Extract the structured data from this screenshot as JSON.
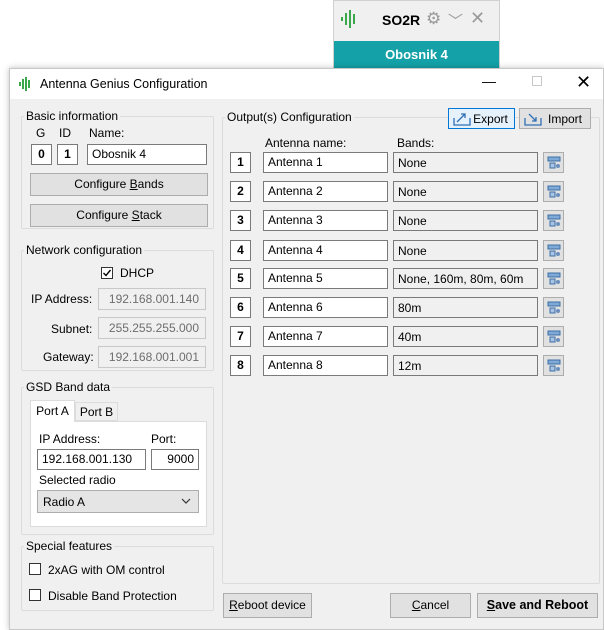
{
  "widget": {
    "title": "SO2R",
    "band": "Obosnik 4"
  },
  "window": {
    "title": "Antenna Genius Configuration"
  },
  "basic": {
    "legend": "Basic information",
    "g_label": "G",
    "id_label": "ID",
    "name_label": "Name:",
    "g": "0",
    "id": "1",
    "name": "Obosnik 4",
    "configure_bands": "Configure Bands",
    "configure_bands_mnemonic": "B",
    "configure_stack": "Configure Stack",
    "configure_stack_mnemonic": "S"
  },
  "network": {
    "legend": "Network configuration",
    "dhcp": "DHCP",
    "dhcp_checked": true,
    "ip_label": "IP Address:",
    "ip": "192.168.001.140",
    "subnet_label": "Subnet:",
    "subnet": "255.255.255.000",
    "gateway_label": "Gateway:",
    "gateway": "192.168.001.001"
  },
  "gsd": {
    "legend": "GSD Band data",
    "tabs": [
      "Port A",
      "Port B"
    ],
    "ip_label": "IP Address:",
    "ip": "192.168.001.130",
    "port_label": "Port:",
    "port": "9000",
    "radio_label": "Selected radio",
    "radio": "Radio A"
  },
  "special": {
    "legend": "Special features",
    "opt1": "2xAG with OM control",
    "opt2": "Disable Band Protection"
  },
  "outputs": {
    "legend": "Output(s) Configuration",
    "export": "Export",
    "import": "Import",
    "antenna_header": "Antenna name:",
    "bands_header": "Bands:",
    "rows": [
      {
        "n": "1",
        "name": "Antenna 1",
        "bands": "None"
      },
      {
        "n": "2",
        "name": "Antenna 2",
        "bands": "None"
      },
      {
        "n": "3",
        "name": "Antenna 3",
        "bands": "None"
      },
      {
        "n": "4",
        "name": "Antenna 4",
        "bands": "None"
      },
      {
        "n": "5",
        "name": "Antenna 5",
        "bands": "None, 160m, 80m, 60m"
      },
      {
        "n": "6",
        "name": "Antenna 6",
        "bands": "80m"
      },
      {
        "n": "7",
        "name": "Antenna 7",
        "bands": "40m"
      },
      {
        "n": "8",
        "name": "Antenna 8",
        "bands": "12m"
      }
    ]
  },
  "footer": {
    "reboot": "Reboot device",
    "cancel": "Cancel",
    "save": "Save and Reboot"
  }
}
